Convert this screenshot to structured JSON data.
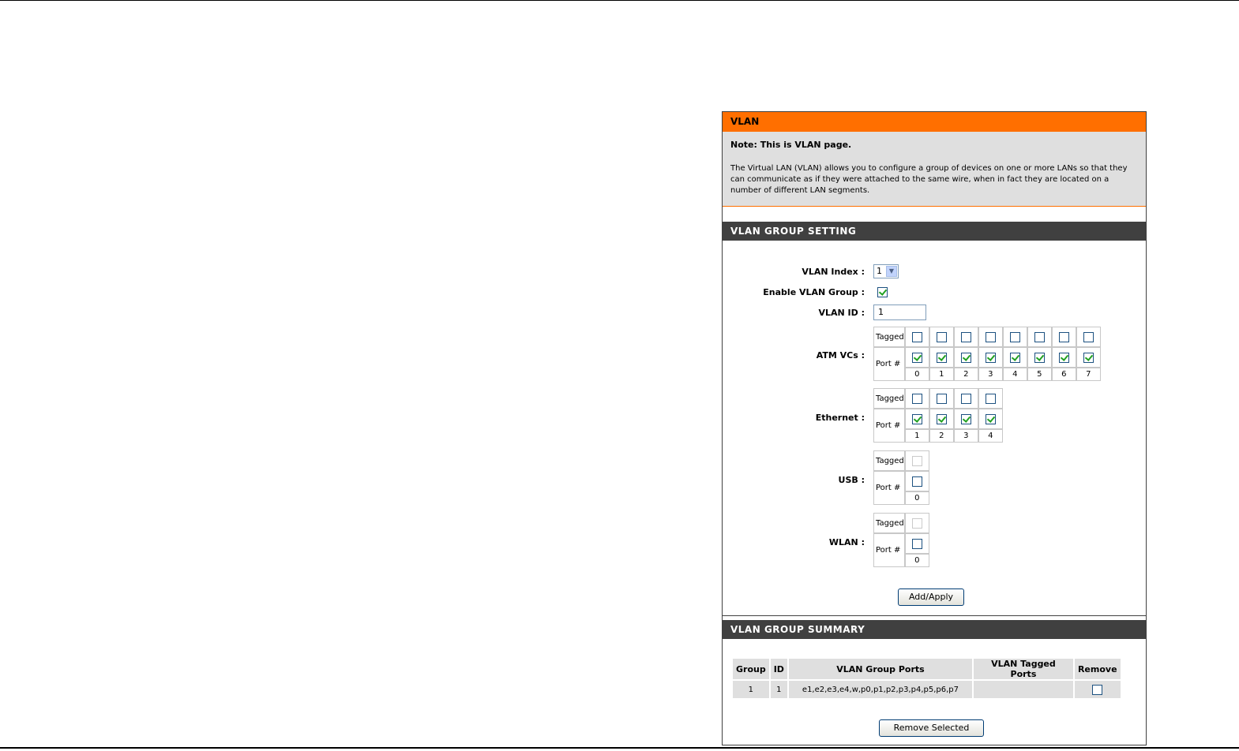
{
  "vlan_section": {
    "title": "VLAN",
    "note_title": "Note: This is VLAN page.",
    "note_text": "The Virtual LAN (VLAN) allows you to configure a group of devices on one or more LANs so that they can communicate as if they were attached to the same wire, when in fact they are located on a number of different LAN segments."
  },
  "group_setting": {
    "title": "VLAN GROUP SETTING",
    "vlan_index_label": "VLAN Index :",
    "vlan_index_value": "1",
    "enable_label": "Enable VLAN Group :",
    "enable_checked": true,
    "vlan_id_label": "VLAN ID :",
    "vlan_id_value": "1",
    "tagged_label": "Tagged",
    "port_label": "Port #",
    "atm": {
      "label": "ATM VCs :",
      "ports": [
        "0",
        "1",
        "2",
        "3",
        "4",
        "5",
        "6",
        "7"
      ],
      "tagged": [
        false,
        false,
        false,
        false,
        false,
        false,
        false,
        false
      ],
      "member": [
        true,
        true,
        true,
        true,
        true,
        true,
        true,
        true
      ]
    },
    "ethernet": {
      "label": "Ethernet :",
      "ports": [
        "1",
        "2",
        "3",
        "4"
      ],
      "tagged": [
        false,
        false,
        false,
        false
      ],
      "member": [
        true,
        true,
        true,
        true
      ]
    },
    "usb": {
      "label": "USB :",
      "ports": [
        "0"
      ],
      "tagged": [
        false
      ],
      "member": [
        false
      ]
    },
    "wlan": {
      "label": "WLAN :",
      "ports": [
        "0"
      ],
      "tagged": [
        false
      ],
      "member": [
        false
      ]
    },
    "apply_button": "Add/Apply"
  },
  "group_summary": {
    "title": "VLAN GROUP SUMMARY",
    "headers": [
      "Group",
      "ID",
      "VLAN Group Ports",
      "VLAN Tagged Ports",
      "Remove"
    ],
    "rows": [
      {
        "group": "1",
        "id": "1",
        "ports": "e1,e2,e3,e4,w,p0,p1,p2,p3,p4,p5,p6,p7",
        "tagged": "",
        "remove": false
      }
    ],
    "remove_button": "Remove Selected"
  }
}
